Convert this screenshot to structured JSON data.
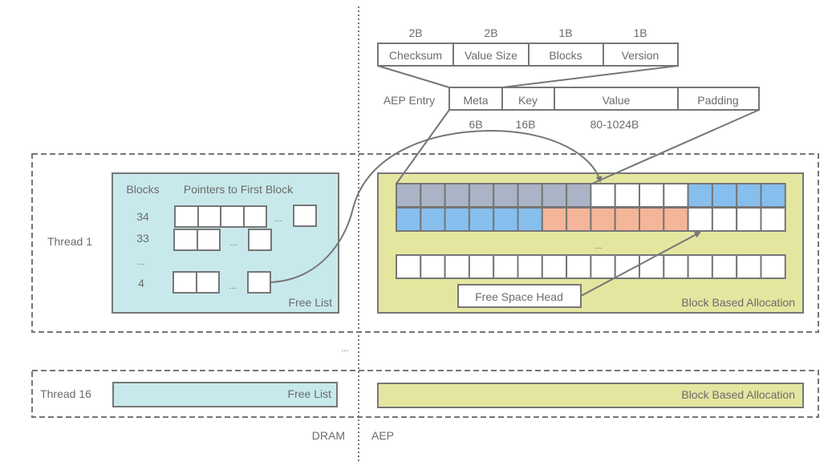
{
  "colors": {
    "stroke": "#767676",
    "free_list_fill": "#c8e9ec",
    "allocation_fill": "#e4e6a0",
    "meta_block": "#aab4c6",
    "blue_block": "#86bfee",
    "salmon_block": "#f5b598",
    "empty_block": "#ffffff"
  },
  "meta_header": {
    "fields": [
      {
        "label": "Checksum",
        "size": "2B"
      },
      {
        "label": "Value Size",
        "size": "2B"
      },
      {
        "label": "Blocks",
        "size": "1B"
      },
      {
        "label": "Version",
        "size": "1B"
      }
    ]
  },
  "aep_entry": {
    "label": "AEP Entry",
    "fields": [
      {
        "label": "Meta",
        "size": "6B"
      },
      {
        "label": "Key",
        "size": "16B"
      },
      {
        "label": "Value",
        "size": "80-1024B"
      },
      {
        "label": "Padding",
        "size": ""
      }
    ]
  },
  "thread1": {
    "label": "Thread 1",
    "free_list": {
      "title": "Free List",
      "col_blocks": "Blocks",
      "col_pointers": "Pointers to First Block",
      "rows": [
        {
          "blocks": "34",
          "ellipsis": "..."
        },
        {
          "blocks": "33",
          "ellipsis": "..."
        },
        {
          "blocks": "...",
          "ellipsis": ""
        },
        {
          "blocks": "4",
          "ellipsis": "..."
        }
      ]
    },
    "allocation": {
      "title": "Block Based Allocation",
      "row1": [
        "meta",
        "meta",
        "meta",
        "meta",
        "meta",
        "meta",
        "meta",
        "meta",
        "empty",
        "empty",
        "empty",
        "empty",
        "blue",
        "blue",
        "blue",
        "blue"
      ],
      "row2": [
        "blue",
        "blue",
        "blue",
        "blue",
        "blue",
        "blue",
        "salmon",
        "salmon",
        "salmon",
        "salmon",
        "salmon",
        "salmon",
        "empty",
        "empty",
        "empty",
        "empty"
      ],
      "row3": [
        "empty",
        "empty",
        "empty",
        "empty",
        "empty",
        "empty",
        "empty",
        "empty",
        "empty",
        "empty",
        "empty",
        "empty",
        "empty",
        "empty",
        "empty",
        "empty"
      ],
      "ellipsis": "...",
      "free_space_head": "Free Space Head"
    }
  },
  "threads_ellipsis": "...",
  "thread16": {
    "label": "Thread 16",
    "free_list_title": "Free List",
    "allocation_title": "Block Based Allocation"
  },
  "regions": {
    "left": "DRAM",
    "right": "AEP"
  }
}
